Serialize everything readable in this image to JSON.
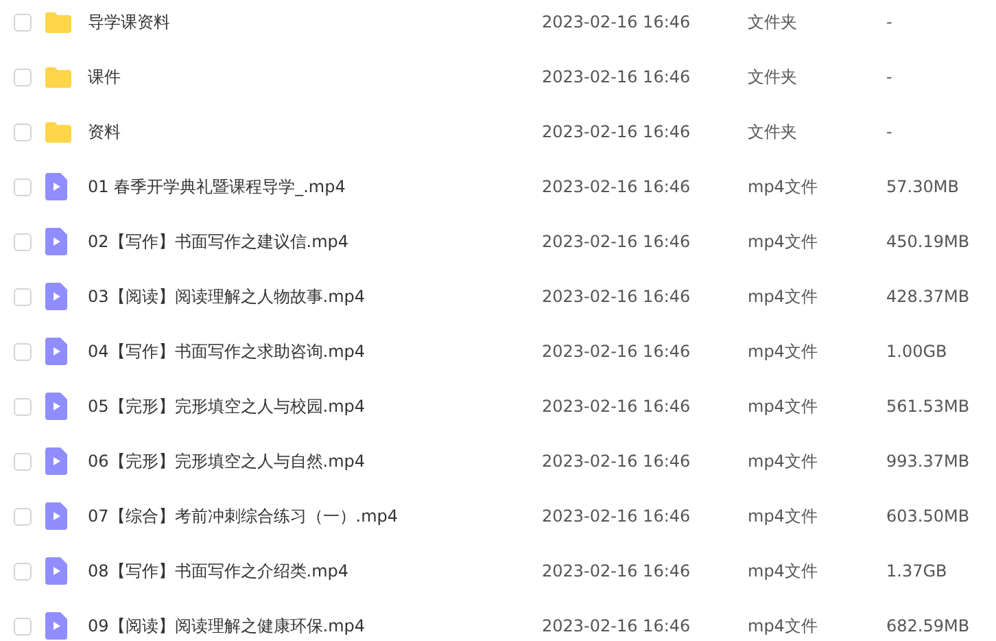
{
  "files": [
    {
      "kind": "folder",
      "name": "导学课资料",
      "modified": "2023-02-16 16:46",
      "type": "文件夹",
      "size": "-",
      "checked": false
    },
    {
      "kind": "folder",
      "name": "课件",
      "modified": "2023-02-16 16:46",
      "type": "文件夹",
      "size": "-",
      "checked": false
    },
    {
      "kind": "folder",
      "name": "资料",
      "modified": "2023-02-16 16:46",
      "type": "文件夹",
      "size": "-",
      "checked": false
    },
    {
      "kind": "video",
      "name": "01 春季开学典礼暨课程导学_.mp4",
      "modified": "2023-02-16 16:46",
      "type": "mp4文件",
      "size": "57.30MB",
      "checked": false
    },
    {
      "kind": "video",
      "name": "02【写作】书面写作之建议信.mp4",
      "modified": "2023-02-16 16:46",
      "type": "mp4文件",
      "size": "450.19MB",
      "checked": false
    },
    {
      "kind": "video",
      "name": "03【阅读】阅读理解之人物故事.mp4",
      "modified": "2023-02-16 16:46",
      "type": "mp4文件",
      "size": "428.37MB",
      "checked": false
    },
    {
      "kind": "video",
      "name": "04【写作】书面写作之求助咨询.mp4",
      "modified": "2023-02-16 16:46",
      "type": "mp4文件",
      "size": "1.00GB",
      "checked": false
    },
    {
      "kind": "video",
      "name": "05【完形】完形填空之人与校园.mp4",
      "modified": "2023-02-16 16:46",
      "type": "mp4文件",
      "size": "561.53MB",
      "checked": false
    },
    {
      "kind": "video",
      "name": "06【完形】完形填空之人与自然.mp4",
      "modified": "2023-02-16 16:46",
      "type": "mp4文件",
      "size": "993.37MB",
      "checked": false
    },
    {
      "kind": "video",
      "name": "07【综合】考前冲刺综合练习（一）.mp4",
      "modified": "2023-02-16 16:46",
      "type": "mp4文件",
      "size": "603.50MB",
      "checked": false
    },
    {
      "kind": "video",
      "name": "08【写作】书面写作之介绍类.mp4",
      "modified": "2023-02-16 16:46",
      "type": "mp4文件",
      "size": "1.37GB",
      "checked": false
    },
    {
      "kind": "video",
      "name": "09【阅读】阅读理解之健康环保.mp4",
      "modified": "2023-02-16 16:46",
      "type": "mp4文件",
      "size": "682.59MB",
      "checked": false
    }
  ]
}
